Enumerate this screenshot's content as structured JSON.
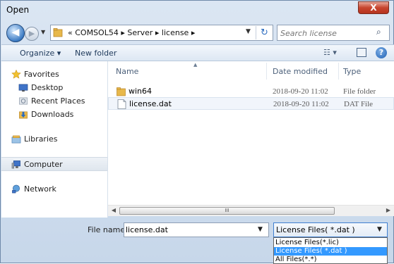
{
  "window": {
    "title": "Open",
    "close_glyph": "X"
  },
  "navigation": {
    "back_glyph": "◀",
    "forward_glyph": "▶",
    "address_path": "« COMSOL54 ▸ Server ▸ license ▸",
    "refresh_glyph": "↻",
    "search_placeholder": "Search license",
    "search_icon": "magnifier"
  },
  "toolbar": {
    "organize_label": "Organize ▾",
    "new_folder_label": "New folder",
    "help_glyph": "?"
  },
  "sidebar": {
    "items": [
      {
        "label": "Favorites",
        "icon": "star-icon"
      },
      {
        "label": "Desktop",
        "icon": "desktop-icon"
      },
      {
        "label": "Recent Places",
        "icon": "recent-places-icon"
      },
      {
        "label": "Downloads",
        "icon": "downloads-icon"
      },
      {
        "label": "Libraries",
        "icon": "libraries-icon"
      },
      {
        "label": "Computer",
        "icon": "computer-icon"
      },
      {
        "label": "Network",
        "icon": "network-icon"
      }
    ]
  },
  "file_list": {
    "columns": [
      "Name",
      "Date modified",
      "Type"
    ],
    "rows": [
      {
        "name": "win64",
        "date": "2018-09-20 11:02",
        "type": "File folder",
        "icon": "folder-icon"
      },
      {
        "name": "license.dat",
        "date": "2018-09-20 11:02",
        "type": "DAT File",
        "icon": "file-icon"
      }
    ]
  },
  "scrollbar": {
    "thumb_glyph": "III"
  },
  "footer": {
    "file_name_label": "File name:",
    "file_name_value": "license.dat",
    "file_type_value": "License Files( *.dat )",
    "file_type_options": [
      "License Files(*.lic)",
      "License Files( *.dat )",
      "All Files(*.*)"
    ]
  },
  "colors": {
    "accent": "#3399ff",
    "close_button": "#c7442e",
    "folder": "#e8b84a"
  }
}
